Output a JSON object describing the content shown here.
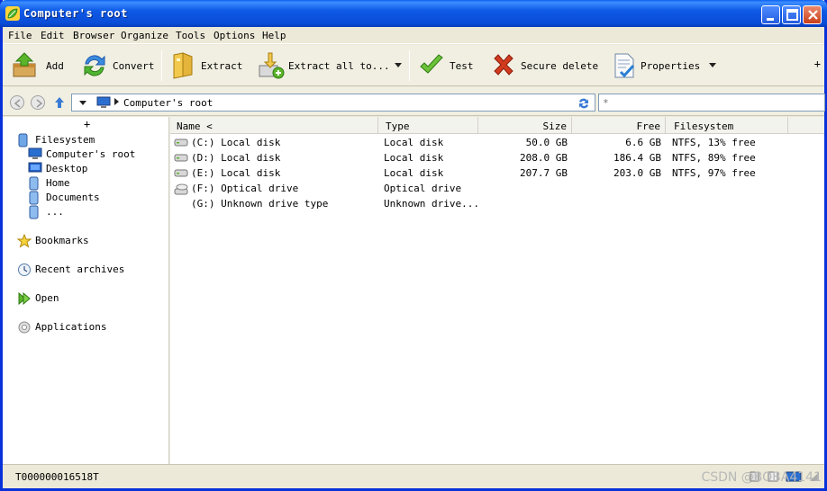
{
  "window": {
    "title": "Computer's root"
  },
  "menu": [
    "File",
    "Edit",
    "Browser",
    "Organize",
    "Tools",
    "Options",
    "Help"
  ],
  "toolbar": {
    "add": "Add",
    "convert": "Convert",
    "extract": "Extract",
    "extract_all": "Extract all to...",
    "test": "Test",
    "secure_delete": "Secure delete",
    "properties": "Properties",
    "more": "+"
  },
  "address": {
    "path": "Computer's root",
    "filter_placeholder": "*"
  },
  "sidebar": {
    "expand": "+",
    "filesystem": "Filesystem",
    "children": [
      "Computer's root",
      "Desktop",
      "Home",
      "Documents",
      "..."
    ],
    "bookmarks": "Bookmarks",
    "recent": "Recent archives",
    "open": "Open",
    "applications": "Applications"
  },
  "table": {
    "headers": {
      "name": "Name <",
      "type": "Type",
      "size": "Size",
      "free": "Free",
      "filesystem": "Filesystem"
    },
    "rows": [
      {
        "name": "(C:) Local disk",
        "type": "Local disk",
        "size": "50.0 GB",
        "free": "6.6 GB",
        "fs": "NTFS, 13% free",
        "icon": "hard-disk-icon"
      },
      {
        "name": "(D:) Local disk",
        "type": "Local disk",
        "size": "208.0 GB",
        "free": "186.4 GB",
        "fs": "NTFS, 89% free",
        "icon": "hard-disk-icon"
      },
      {
        "name": "(E:) Local disk",
        "type": "Local disk",
        "size": "207.7 GB",
        "free": "203.0 GB",
        "fs": "NTFS, 97% free",
        "icon": "hard-disk-icon"
      },
      {
        "name": "(F:) Optical drive",
        "type": "Optical drive",
        "size": "",
        "free": "",
        "fs": "",
        "icon": "optical-drive-icon"
      },
      {
        "name": "(G:) Unknown drive type",
        "type": "Unknown drive...",
        "size": "",
        "free": "",
        "fs": "",
        "icon": "none"
      }
    ]
  },
  "status": {
    "text": "T000000016518T"
  },
  "watermark": "CSDN @BOBA4141",
  "colors": {
    "titlebar": "#0a4bd6",
    "toolbar_bg": "#f1efe2",
    "accent_green": "#5bb42a",
    "delete_red": "#d23a1e"
  }
}
